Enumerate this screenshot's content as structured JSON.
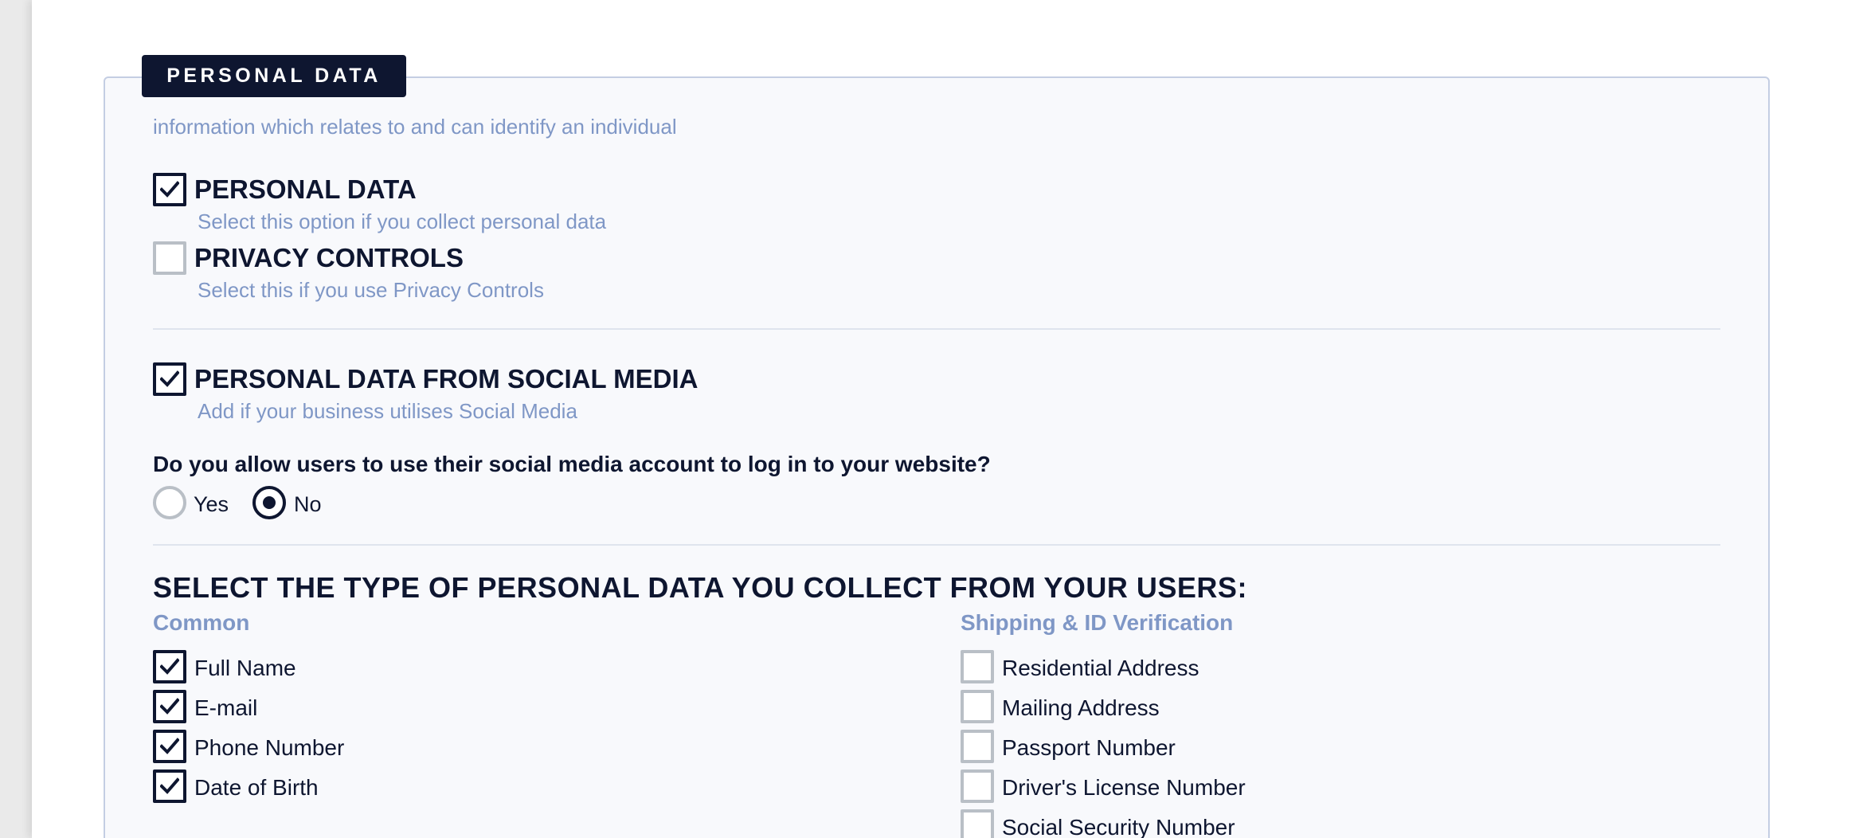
{
  "section": {
    "legend": "PERSONAL DATA",
    "description": "information which relates to and can identify an individual"
  },
  "options": [
    {
      "title": "PERSONAL DATA",
      "hint": "Select this option if you collect personal data",
      "checked": true
    },
    {
      "title": "PRIVACY CONTROLS",
      "hint": "Select this if you use Privacy Controls",
      "checked": false
    },
    {
      "title": "PERSONAL DATA FROM SOCIAL MEDIA",
      "hint": "Add if your business utilises Social Media",
      "checked": true
    }
  ],
  "social_login": {
    "question": "Do you allow users to use their social media account to log in to your website?",
    "choices": [
      "Yes",
      "No"
    ],
    "selected": "No"
  },
  "data_types": {
    "heading": "SELECT THE TYPE OF PERSONAL DATA YOU COLLECT FROM YOUR USERS:",
    "groups": [
      {
        "name": "Common",
        "items": [
          {
            "label": "Full Name",
            "checked": true
          },
          {
            "label": "E-mail",
            "checked": true
          },
          {
            "label": "Phone Number",
            "checked": true
          },
          {
            "label": "Date of Birth",
            "checked": true
          }
        ]
      },
      {
        "name": "Shipping & ID Verification",
        "items": [
          {
            "label": "Residential Address",
            "checked": false
          },
          {
            "label": "Mailing Address",
            "checked": false
          },
          {
            "label": "Passport Number",
            "checked": false
          },
          {
            "label": "Driver's License Number",
            "checked": false
          },
          {
            "label": "Social Security Number",
            "checked": false
          }
        ]
      }
    ]
  },
  "icons": {
    "check": "checkmark-icon"
  },
  "colors": {
    "navy": "#0e1630",
    "muted_blue": "#7f97c6",
    "panel_bg": "#f8f9fc",
    "border": "#c4cee3"
  }
}
